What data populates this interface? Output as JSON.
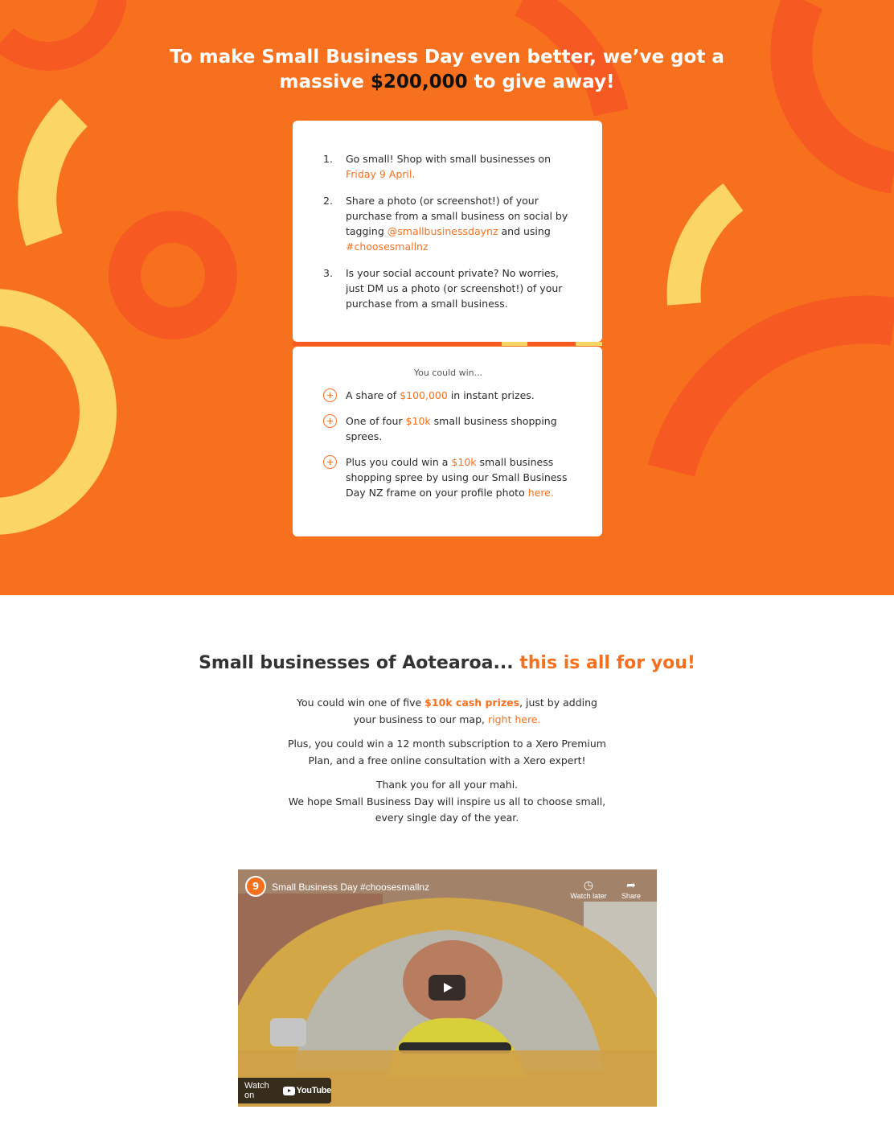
{
  "hero": {
    "title_part1": "To make Small Business Day even better, we’ve got a",
    "title_part2": "massive",
    "title_amount": "$200,000",
    "title_part3": "to give away!"
  },
  "steps": [
    {
      "num": "1.",
      "text_a": "Go small! Shop with small businesses on",
      "highlight": "Friday 9 April.",
      "text_b": ""
    },
    {
      "num": "2.",
      "text_a": "Share a photo (or screenshot!) of your purchase from a small business on social by tagging",
      "highlight": "@smallbusinessdaynz",
      "text_b": "and using",
      "highlight2": "#choosesmallnz"
    },
    {
      "num": "3.",
      "text_a": "Is your social account private? No worries, just DM us a photo (or screenshot!) of your purchase from a small business."
    }
  ],
  "prizes": {
    "title": "You could win...",
    "items": [
      {
        "a": "A share of",
        "hl": "$100,000",
        "b": "in instant prizes."
      },
      {
        "a": "One of four",
        "hl": "$10k",
        "b": "small business shopping sprees."
      },
      {
        "a": "Plus you could win a",
        "hl": "$10k",
        "b": "small business shopping spree by using our Small Business Day NZ frame on your profile photo",
        "link": "here."
      }
    ]
  },
  "section": {
    "title_a": "Small businesses of Aotearoa...",
    "title_b": "this is all for you!",
    "p1_a": "You could win one of five",
    "p1_hl": "$10k cash prizes",
    "p1_b": ", just by adding your business to our map,",
    "p1_link": "right here.",
    "p2": "Plus, you could win a 12 month subscription to a Xero Premium Plan, and a free online consultation with a Xero expert!",
    "p3_line1": "Thank you for all your mahi.",
    "p3_line2": "We hope Small Business Day will inspire us all to choose small, every single day of the year."
  },
  "video": {
    "channel_badge": "9",
    "title": "Small Business Day #choosesmallnz",
    "watch_later": "Watch later",
    "share": "Share",
    "watch_on": "Watch on",
    "youtube": "YouTube"
  },
  "colors": {
    "orange": "#f7701e",
    "dark_orange": "#f65a22",
    "yellow": "#fbd566"
  }
}
